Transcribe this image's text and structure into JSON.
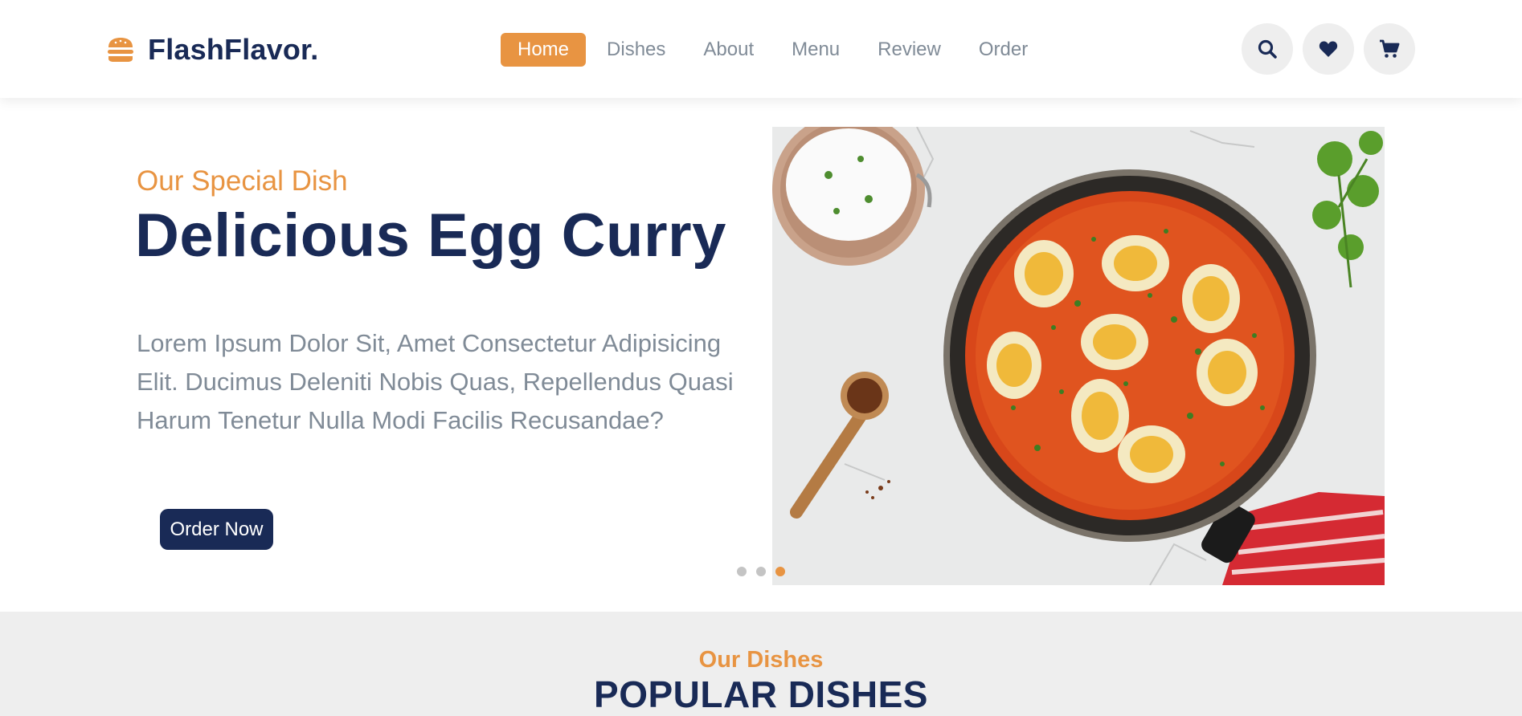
{
  "brand": {
    "name": "FlashFlavor.",
    "icon": "hamburger-icon",
    "accent_color": "#e89442",
    "primary_color": "#192a56"
  },
  "nav": {
    "links": [
      {
        "label": "Home",
        "active": true
      },
      {
        "label": "Dishes",
        "active": false
      },
      {
        "label": "About",
        "active": false
      },
      {
        "label": "Menu",
        "active": false
      },
      {
        "label": "Review",
        "active": false
      },
      {
        "label": "Order",
        "active": false
      }
    ]
  },
  "header_icons": [
    "search-icon",
    "heart-icon",
    "cart-icon"
  ],
  "hero": {
    "subtitle": "Our Special Dish",
    "title": "Delicious Egg Curry",
    "description": "Lorem Ipsum Dolor Sit, Amet Consectetur Adipisicing Elit. Ducimus Deleniti Nobis Quas, Repellendus Quasi Harum Tenetur Nulla Modi Facilis Recusandae?",
    "button_label": "Order Now",
    "slider": {
      "total": 3,
      "active_index": 3
    }
  },
  "dishes_section": {
    "subtitle": "Our Dishes",
    "title": "POPULAR DISHES"
  }
}
